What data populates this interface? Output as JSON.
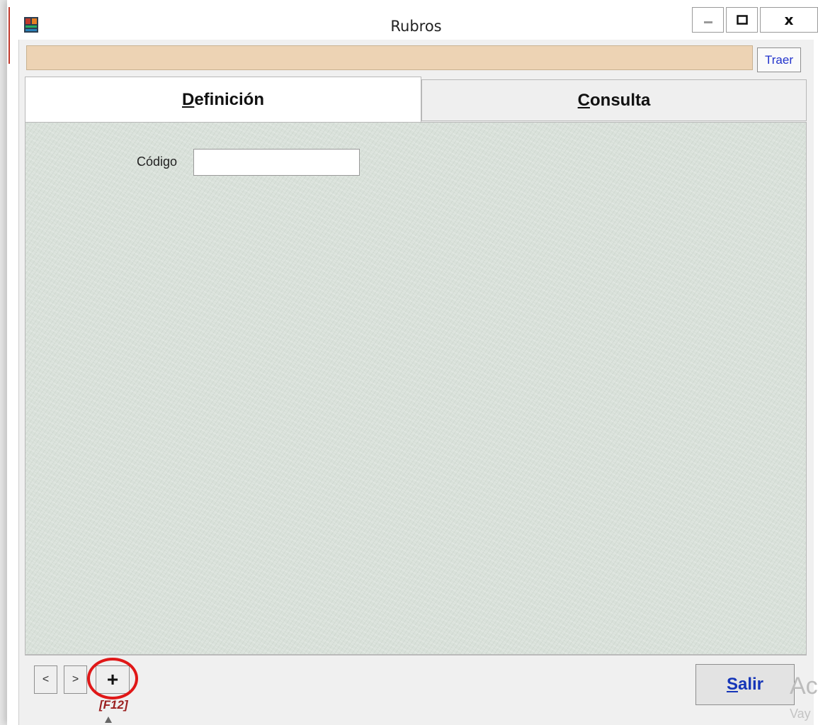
{
  "window": {
    "title": "Rubros",
    "icon": "app-icon",
    "controls": {
      "minimize_icon": "minimize-icon",
      "maximize_icon": "maximize-icon",
      "close_label": "x"
    }
  },
  "toolbar": {
    "traer_label": "Traer"
  },
  "tabs": [
    {
      "accel": "D",
      "rest": "efinición",
      "active": true
    },
    {
      "accel": "C",
      "rest": "onsulta",
      "active": false
    }
  ],
  "form": {
    "codigo_label": "Código",
    "codigo_value": ""
  },
  "footer": {
    "prev_label": "<",
    "next_label": ">",
    "add_label": "+",
    "add_shortcut": "[F12]",
    "salir_accel": "S",
    "salir_rest": "alir"
  },
  "watermark": {
    "line1": "Ac",
    "line2": "Vay"
  },
  "colors": {
    "accent_bar": "#edd3b4",
    "panel_bg": "#d9e1da",
    "link_blue": "#2233cc",
    "salir_blue": "#1535b8",
    "highlight_red": "#e01818",
    "shortcut_red": "#9b2020"
  }
}
